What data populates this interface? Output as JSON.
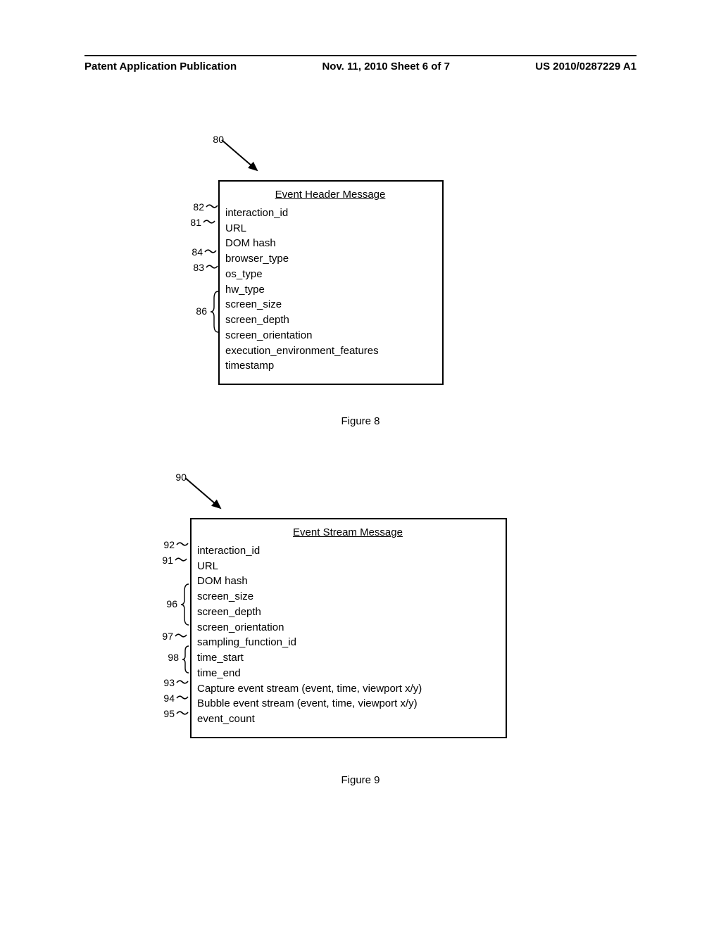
{
  "header": {
    "left": "Patent Application Publication",
    "center": "Nov. 11, 2010  Sheet 6 of 7",
    "right": "US 2010/0287229 A1"
  },
  "fig8": {
    "arrow_ref": "80",
    "title": "Event Header Message",
    "rows": [
      "interaction_id",
      "URL",
      "DOM hash",
      "browser_type",
      "os_type",
      "hw_type",
      "screen_size",
      "screen_depth",
      "screen_orientation",
      "execution_environment_features",
      "timestamp"
    ],
    "refs": {
      "r82": "82",
      "r81": "81",
      "r84": "84",
      "r83": "83",
      "r86": "86"
    },
    "caption": "Figure 8"
  },
  "fig9": {
    "arrow_ref": "90",
    "title": "Event Stream Message",
    "rows": [
      "interaction_id",
      "URL",
      "DOM hash",
      "screen_size",
      "screen_depth",
      "screen_orientation",
      "sampling_function_id",
      "time_start",
      "time_end",
      "Capture event stream (event, time, viewport x/y)",
      "Bubble event stream (event, time, viewport x/y)",
      "event_count"
    ],
    "refs": {
      "r92": "92",
      "r91": "91",
      "r96": "96",
      "r97": "97",
      "r98": "98",
      "r93": "93",
      "r94": "94",
      "r95": "95"
    },
    "caption": "Figure 9"
  }
}
